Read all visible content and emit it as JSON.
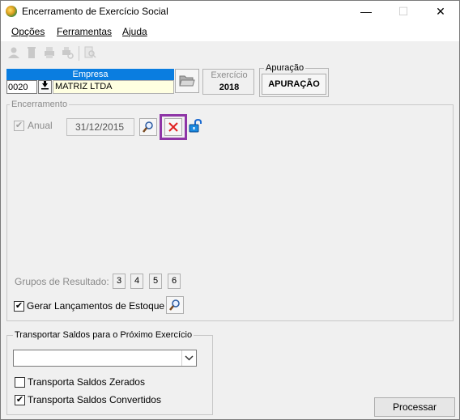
{
  "window": {
    "title": "Encerramento de Exercício Social",
    "minimize": "—",
    "maximize": "☐",
    "close": "✕"
  },
  "menu": [
    {
      "label": "Opções"
    },
    {
      "label": "Ferramentas"
    },
    {
      "label": "Ajuda"
    }
  ],
  "toolbar": {
    "icons": [
      "user-icon",
      "trash-icon",
      "print-icon",
      "print-preview-icon",
      "search-doc-icon"
    ]
  },
  "empresa": {
    "header": "Empresa",
    "code": "0020",
    "name": "MATRIZ LTDA"
  },
  "exercicio": {
    "label": "Exercício",
    "value": "2018"
  },
  "apuracao": {
    "legend": "Apuração",
    "button": "APURAÇÃO"
  },
  "encerramento": {
    "legend": "Encerramento",
    "anual_label": "Anual",
    "anual_checked": true,
    "date": "31/12/2015",
    "grupos_label": "Grupos de Resultado:",
    "grupos": [
      "3",
      "4",
      "5",
      "6"
    ],
    "gerar_label": "Gerar Lançamentos de Estoque",
    "gerar_checked": true
  },
  "transportar": {
    "legend": "Transportar Saldos para o Próximo Exercício",
    "combo_value": "",
    "zerados_label": "Transporta Saldos Zerados",
    "zerados_checked": false,
    "convertidos_label": "Transporta Saldos Convertidos",
    "convertidos_checked": true
  },
  "processar_label": "Processar",
  "colors": {
    "accent": "#0a7de0",
    "highlight": "#8e35a6",
    "delete_red": "#e02020",
    "field_yellow": "#ffffe1"
  }
}
